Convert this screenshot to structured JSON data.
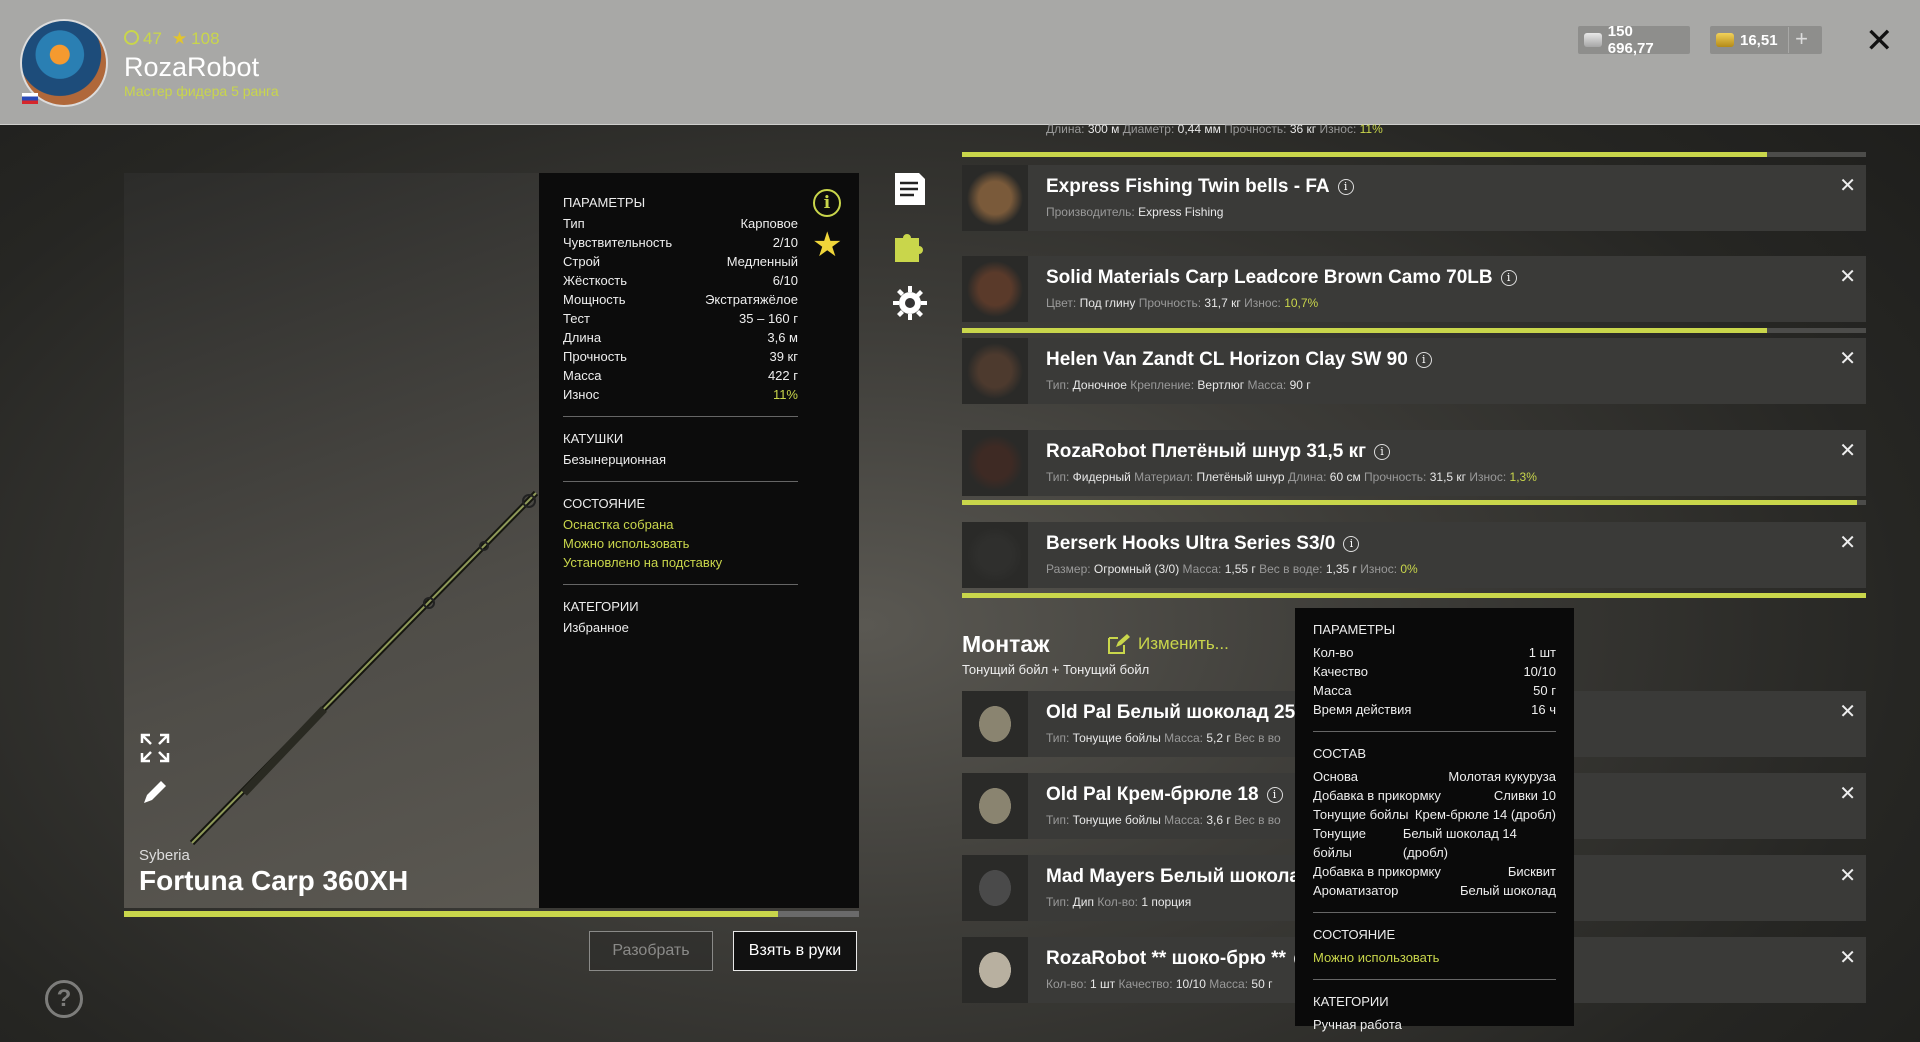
{
  "header": {
    "level": "47",
    "rating": "108",
    "username": "RozaRobot",
    "rank": "Мастер фидера 5 ранга",
    "silver": "150 696,77",
    "gold": "16,51",
    "plus": "+",
    "close": "✕"
  },
  "rod": {
    "brand": "Syberia",
    "name": "Fortuna Carp 360XH",
    "wear_fraction": 0.89,
    "params_title": "ПАРАМЕТРЫ",
    "params": [
      {
        "k": "Тип",
        "v": "Карповое"
      },
      {
        "k": "Чувствительность",
        "v": "2/10"
      },
      {
        "k": "Строй",
        "v": "Медленный"
      },
      {
        "k": "Жёсткость",
        "v": "6/10"
      },
      {
        "k": "Мощность",
        "v": "Экстратяжёлое"
      },
      {
        "k": "Тест",
        "v": "35 – 160 г"
      },
      {
        "k": "Длина",
        "v": "3,6 м"
      },
      {
        "k": "Прочность",
        "v": "39 кг"
      },
      {
        "k": "Масса",
        "v": "422 г"
      },
      {
        "k": "Износ",
        "v": "11%"
      }
    ],
    "reels_title": "КАТУШКИ",
    "reels": "Безынерционная",
    "state_title": "СОСТОЯНИЕ",
    "state": [
      "Оснастка собрана",
      "Можно использовать",
      "Установлено на подставку"
    ],
    "cat_title": "КАТЕГОРИИ",
    "category": "Избранное",
    "btn_disassemble": "Разобрать",
    "btn_take": "Взять в руки"
  },
  "items": [
    {
      "title": "",
      "desc_html": "",
      "partial_desc": [
        "Длина:",
        "300 м",
        "Диаметр:",
        "0,44 мм",
        "Прочность:",
        "36 кг",
        "Износ:",
        "11%"
      ]
    },
    {
      "title": "Express Fishing Twin bells - FA",
      "d": [
        [
          "Производитель:",
          "Express Fishing"
        ]
      ]
    },
    {
      "title": "Solid Materials Carp Leadcore Brown Camo 70LB",
      "d": [
        [
          "Цвет:",
          "Под глину"
        ],
        [
          "Прочность:",
          "31,7 кг"
        ],
        [
          "Износ:",
          "10,7%"
        ]
      ]
    },
    {
      "title": "Helen Van Zandt CL Horizon Clay SW 90",
      "d": [
        [
          "Тип:",
          "Доночное"
        ],
        [
          "Крепление:",
          "Вертлюг"
        ],
        [
          "Масса:",
          "90 г"
        ]
      ]
    },
    {
      "title": "RozaRobot Плетёный шнур 31,5 кг",
      "d": [
        [
          "Тип:",
          "Фидерный"
        ],
        [
          "Материал:",
          "Плетёный шнур"
        ],
        [
          "Длина:",
          "60 см"
        ],
        [
          "Прочность:",
          "31,5 кг"
        ],
        [
          "Износ:",
          "1,3%"
        ]
      ]
    },
    {
      "title": "Berserk Hooks Ultra Series S3/0",
      "d": [
        [
          "Размер:",
          "Огромный (3/0)"
        ],
        [
          "Масса:",
          "1,55 г"
        ],
        [
          "Вес в воде:",
          "1,35 г"
        ],
        [
          "Износ:",
          "0%"
        ]
      ]
    }
  ],
  "montage": {
    "title": "Монтаж",
    "edit": "Изменить...",
    "subtitle": "Тонущий бойл + Тонущий бойл",
    "items": [
      {
        "title": "Old Pal Белый шоколад 25",
        "d": [
          [
            "Тип:",
            "Тонущие бойлы"
          ],
          [
            "Масса:",
            "5,2 г"
          ],
          [
            "Вес в во",
            ""
          ]
        ]
      },
      {
        "title": "Old Pal Крем-брюле 18",
        "d": [
          [
            "Тип:",
            "Тонущие бойлы"
          ],
          [
            "Масса:",
            "3,6 г"
          ],
          [
            "Вес в во",
            ""
          ]
        ]
      },
      {
        "title": "Mad Mayers Белый шоколад",
        "d": [
          [
            "Тип:",
            "Дип"
          ],
          [
            "Кол-во:",
            "1 порция"
          ]
        ]
      },
      {
        "title": "RozaRobot ** шоко-брю **",
        "d": [
          [
            "Кол-во:",
            "1 шт"
          ],
          [
            "Качество:",
            "10/10"
          ],
          [
            "Масса:",
            "50 г"
          ]
        ]
      }
    ]
  },
  "tooltip": {
    "params_title": "ПАРАМЕТРЫ",
    "params": [
      {
        "k": "Кол-во",
        "v": "1 шт"
      },
      {
        "k": "Качество",
        "v": "10/10"
      },
      {
        "k": "Масса",
        "v": "50 г"
      },
      {
        "k": "Время действия",
        "v": "16 ч"
      }
    ],
    "comp_title": "СОСТАВ",
    "composition": [
      {
        "k": "Основа",
        "v": "Молотая кукуруза"
      },
      {
        "k": "Добавка в прикормку",
        "v": "Сливки 10"
      },
      {
        "k": "Тонущие бойлы",
        "v": "Крем-брюле 14 (дробл)"
      },
      {
        "k": "Тонущие бойлы",
        "v": "Белый шоколад 14 (дробл)"
      },
      {
        "k": "Добавка в прикормку",
        "v": "Бисквит"
      },
      {
        "k": "Ароматизатор",
        "v": "Белый шоколад"
      }
    ],
    "state_title": "СОСТОЯНИЕ",
    "state": "Можно использовать",
    "cat_title": "КАТЕГОРИИ",
    "category": "Ручная работа"
  },
  "colors": {
    "accent": "#c9d64b",
    "star": "#f0d63a"
  },
  "bars": [
    0.89,
    0.89,
    0.99,
    1.0
  ]
}
